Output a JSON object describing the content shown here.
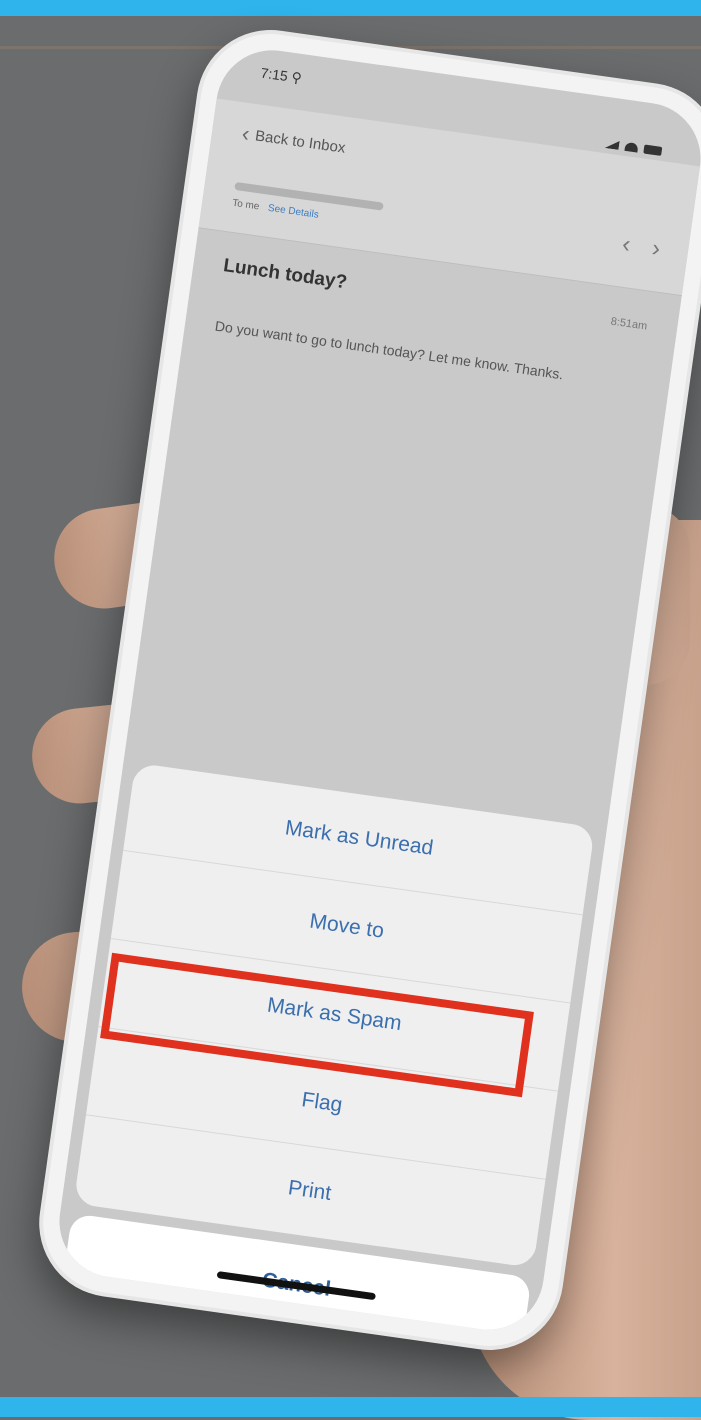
{
  "status_bar": {
    "time": "7:15 ⚲"
  },
  "header": {
    "back_label": "Back to Inbox",
    "to_prefix": "To me",
    "see_details": "See Details"
  },
  "email": {
    "subject": "Lunch today?",
    "time": "8:51am",
    "body": "Do you want to go to lunch today? Let me know. Thanks."
  },
  "action_sheet": {
    "items": [
      {
        "label": "Mark as Unread"
      },
      {
        "label": "Move to"
      },
      {
        "label": "Mark as Spam"
      },
      {
        "label": "Flag"
      },
      {
        "label": "Print"
      }
    ],
    "cancel_label": "Cancel",
    "highlighted_item": "Mark as Spam"
  },
  "colors": {
    "frame_accent": "#2fb4ec",
    "highlight_border": "#e0301e",
    "action_text": "#3b6fae"
  }
}
